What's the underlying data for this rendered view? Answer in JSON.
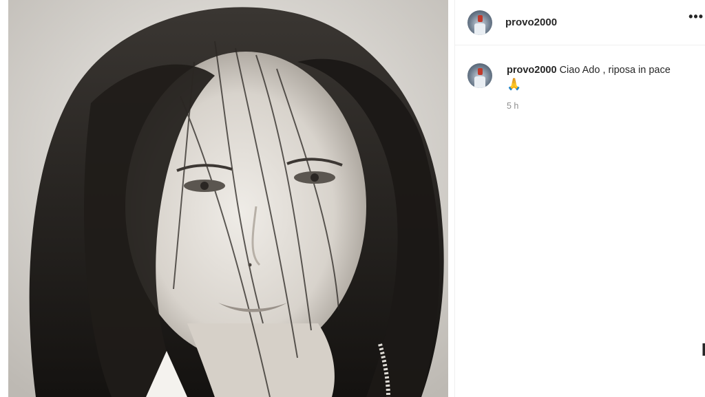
{
  "header": {
    "username": "provo2000",
    "more_icon": "more-horizontal-icon",
    "more_label": "•••"
  },
  "photo": {
    "icon": "portrait-photo",
    "colors": {
      "background": "#d9d6d1",
      "hair": "#2a2724",
      "skin": "#e6e2dc"
    }
  },
  "comment": {
    "username": "provo2000",
    "text": "Ciao Ado , riposa in pace",
    "emoji": "🙏",
    "time": "5 h"
  },
  "edge_glyph": "I"
}
